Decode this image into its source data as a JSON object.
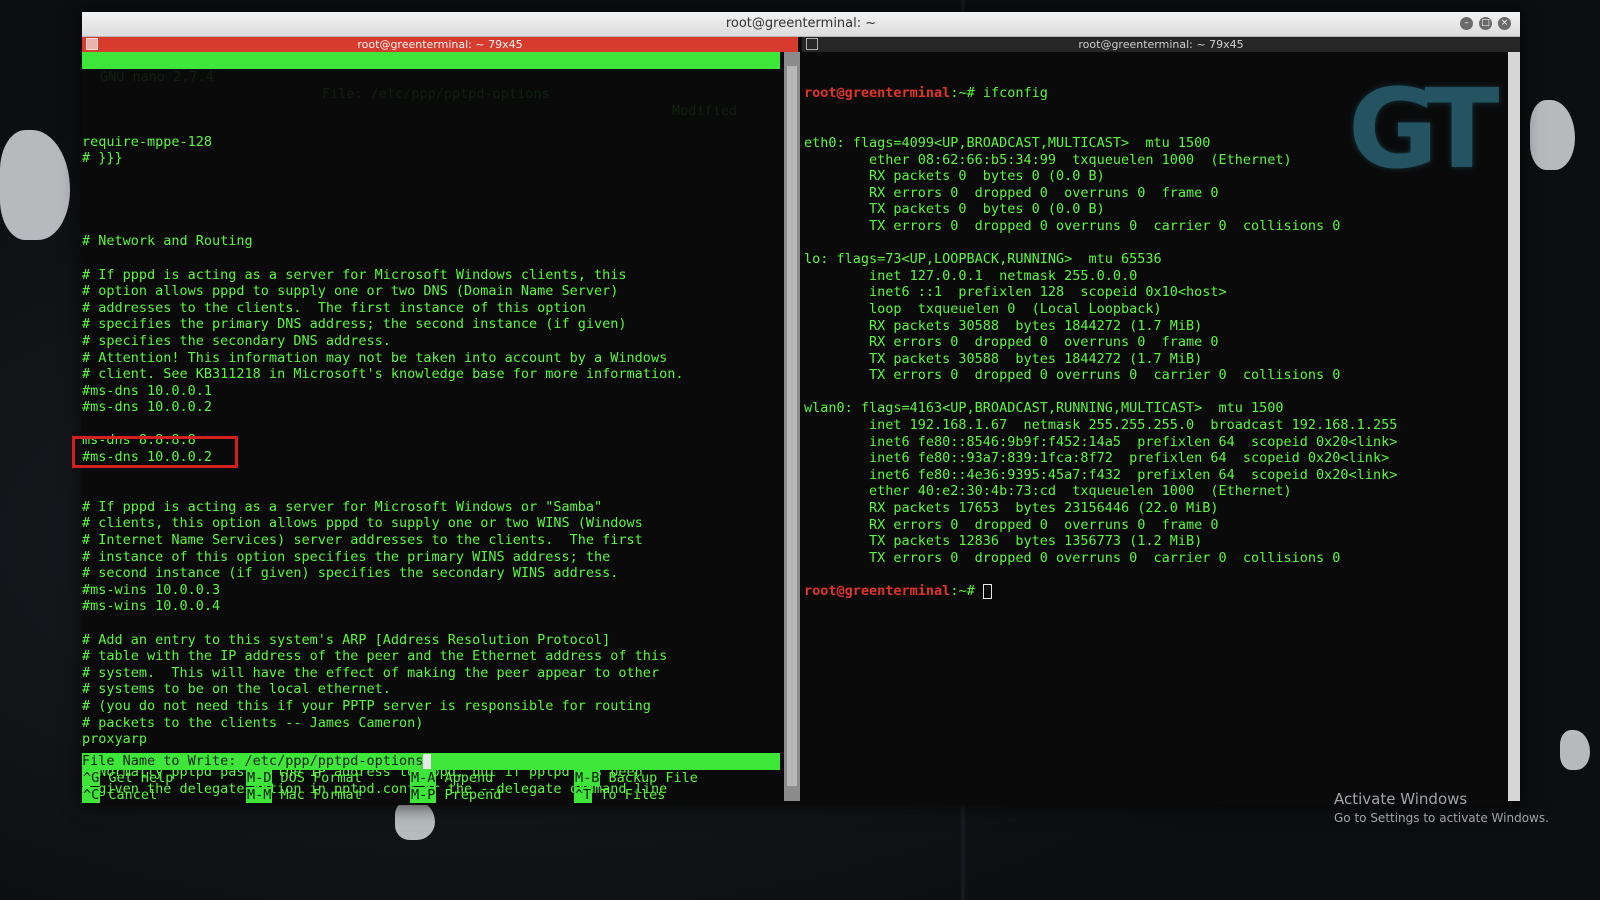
{
  "window": {
    "title": "root@greenterminal: ~",
    "btn_min": "–",
    "btn_max": "□",
    "btn_close": "×"
  },
  "left_pane": {
    "title": "root@greenterminal: ~ 79x45",
    "nano_version": "GNU nano 2.7.4",
    "file_label": "File: /etc/ppp/pptpd-options",
    "modified": "Modified",
    "lines": [
      "require-mppe-128",
      "# }}}",
      "",
      "",
      "",
      "",
      "# Network and Routing",
      "",
      "# If pppd is acting as a server for Microsoft Windows clients, this",
      "# option allows pppd to supply one or two DNS (Domain Name Server)",
      "# addresses to the clients.  The first instance of this option",
      "# specifies the primary DNS address; the second instance (if given)",
      "# specifies the secondary DNS address.",
      "# Attention! This information may not be taken into account by a Windows",
      "# client. See KB311218 in Microsoft's knowledge base for more information.",
      "#ms-dns 10.0.0.1",
      "#ms-dns 10.0.0.2",
      "",
      "ms-dns 8.8.8.8",
      "#ms-dns 10.0.0.2",
      "",
      "",
      "# If pppd is acting as a server for Microsoft Windows or \"Samba\"",
      "# clients, this option allows pppd to supply one or two WINS (Windows",
      "# Internet Name Services) server addresses to the clients.  The first",
      "# instance of this option specifies the primary WINS address; the",
      "# second instance (if given) specifies the secondary WINS address.",
      "#ms-wins 10.0.0.3",
      "#ms-wins 10.0.0.4",
      "",
      "# Add an entry to this system's ARP [Address Resolution Protocol]",
      "# table with the IP address of the peer and the Ethernet address of this",
      "# system.  This will have the effect of making the peer appear to other",
      "# systems to be on the local ethernet.",
      "# (you do not need this if your PPTP server is responsible for routing",
      "# packets to the clients -- James Cameron)",
      "proxyarp",
      "",
      "# Normally pptpd passes the IP address to pppd, but if pptpd has been",
      "# given the delegate option in pptpd.conf or the --delegate command line"
    ],
    "filename_prompt": "File Name to Write: /etc/ppp/pptpd-options",
    "shortcuts": [
      {
        "key": "^G",
        "label": "Get Help"
      },
      {
        "key": "M-D",
        "label": "DOS Format"
      },
      {
        "key": "M-A",
        "label": "Append"
      },
      {
        "key": "M-B",
        "label": "Backup File"
      },
      {
        "key": "^C",
        "label": "Cancel"
      },
      {
        "key": "M-M",
        "label": "Mac Format"
      },
      {
        "key": "M-P",
        "label": "Prepend"
      },
      {
        "key": "^T",
        "label": "To Files"
      }
    ]
  },
  "right_pane": {
    "title": "root@greenterminal: ~ 79x45",
    "prompt_user": "root@greenterminal",
    "prompt_suffix": ":~# ",
    "command": "ifconfig",
    "output": [
      "eth0: flags=4099<UP,BROADCAST,MULTICAST>  mtu 1500",
      "        ether 08:62:66:b5:34:99  txqueuelen 1000  (Ethernet)",
      "        RX packets 0  bytes 0 (0.0 B)",
      "        RX errors 0  dropped 0  overruns 0  frame 0",
      "        TX packets 0  bytes 0 (0.0 B)",
      "        TX errors 0  dropped 0 overruns 0  carrier 0  collisions 0",
      "",
      "lo: flags=73<UP,LOOPBACK,RUNNING>  mtu 65536",
      "        inet 127.0.0.1  netmask 255.0.0.0",
      "        inet6 ::1  prefixlen 128  scopeid 0x10<host>",
      "        loop  txqueuelen 0  (Local Loopback)",
      "        RX packets 30588  bytes 1844272 (1.7 MiB)",
      "        RX errors 0  dropped 0  overruns 0  frame 0",
      "        TX packets 30588  bytes 1844272 (1.7 MiB)",
      "        TX errors 0  dropped 0 overruns 0  carrier 0  collisions 0",
      "",
      "wlan0: flags=4163<UP,BROADCAST,RUNNING,MULTICAST>  mtu 1500",
      "        inet 192.168.1.67  netmask 255.255.255.0  broadcast 192.168.1.255",
      "        inet6 fe80::8546:9b9f:f452:14a5  prefixlen 64  scopeid 0x20<link>",
      "        inet6 fe80::93a7:839:1fca:8f72  prefixlen 64  scopeid 0x20<link>",
      "        inet6 fe80::4e36:9395:45a7:f432  prefixlen 64  scopeid 0x20<link>",
      "        ether 40:e2:30:4b:73:cd  txqueuelen 1000  (Ethernet)",
      "        RX packets 17653  bytes 23156446 (22.0 MiB)",
      "        RX errors 0  dropped 0  overruns 0  frame 0",
      "        TX packets 12836  bytes 1356773 (1.2 MiB)",
      "        TX errors 0  dropped 0 overruns 0  carrier 0  collisions 0",
      ""
    ]
  },
  "logo": {
    "text": "GT"
  },
  "watermark": {
    "line1": "Activate Windows",
    "line2": "Go to Settings to activate Windows."
  },
  "colors": {
    "terminal_green": "#5df53f",
    "bar_green": "#3fe63a",
    "prompt_red": "#e0342a",
    "highlight_red": "#d61f1f"
  }
}
